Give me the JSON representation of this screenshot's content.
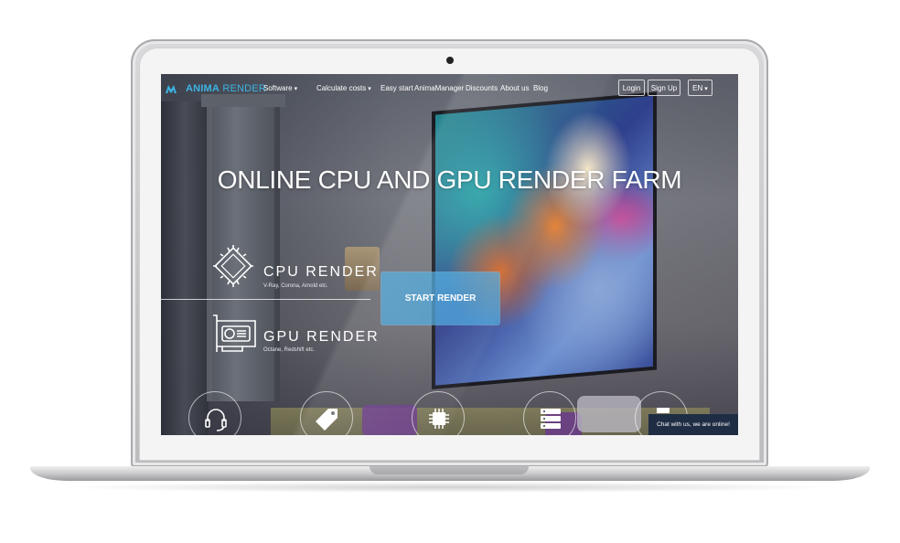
{
  "nav": {
    "brand_bold": "ANIMA",
    "brand_rest": " RENDER",
    "software": "Software",
    "calculate": "Calculate costs",
    "easy_start": "Easy start",
    "anima_manager": "AnimaManager",
    "discounts": "Discounts",
    "about": "About us",
    "blog": "Blog",
    "login": "Login",
    "signup": "Sign Up",
    "lang": "EN"
  },
  "hero": {
    "title": "ONLINE CPU AND GPU RENDER FARM",
    "start_button": "START RENDER"
  },
  "features": {
    "cpu_title": "CPU RENDER",
    "cpu_sub": "V-Ray, Corona, Arnold etc.",
    "gpu_title": "GPU RENDER",
    "gpu_sub": "Octane, Redshift etc."
  },
  "chat": {
    "label": "Chat with us, we are online!"
  },
  "colors": {
    "brand": "#3db3e3",
    "start_button": "#48a9e1",
    "chat_bg": "#1f2d44"
  }
}
